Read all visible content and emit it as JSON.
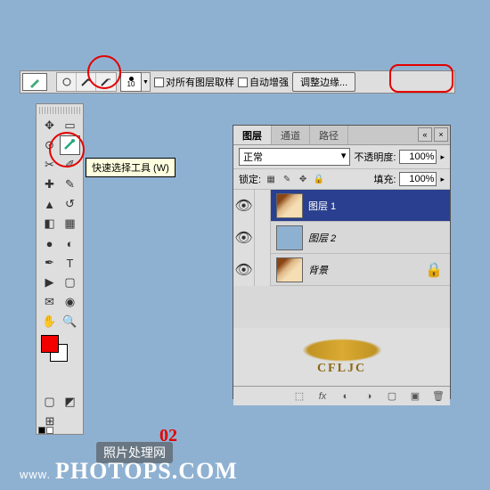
{
  "optionsBar": {
    "brushSize": "10",
    "sampleAllLabel": "对所有图层取样",
    "autoEnhanceLabel": "自动增强",
    "refineEdgeLabel": "调整边缘..."
  },
  "tooltip": "快速选择工具 (W)",
  "panel": {
    "tabs": [
      "图层",
      "通道",
      "路径"
    ],
    "blendMode": "正常",
    "opacityLabel": "不透明度:",
    "opacityVal": "100%",
    "lockLabel": "锁定:",
    "fillLabel": "填充:",
    "fillVal": "100%",
    "layers": [
      {
        "name": "图层 1",
        "sel": true,
        "thumb": "img"
      },
      {
        "name": "图层 2",
        "sel": false,
        "thumb": "blue"
      },
      {
        "name": "背景",
        "sel": false,
        "thumb": "img",
        "locked": true
      }
    ],
    "logoText": "CFLJC"
  },
  "marker": "02",
  "watermark": {
    "www": "www.",
    "cn": "照片处理网",
    "big": "PHOTOPS.COM"
  }
}
